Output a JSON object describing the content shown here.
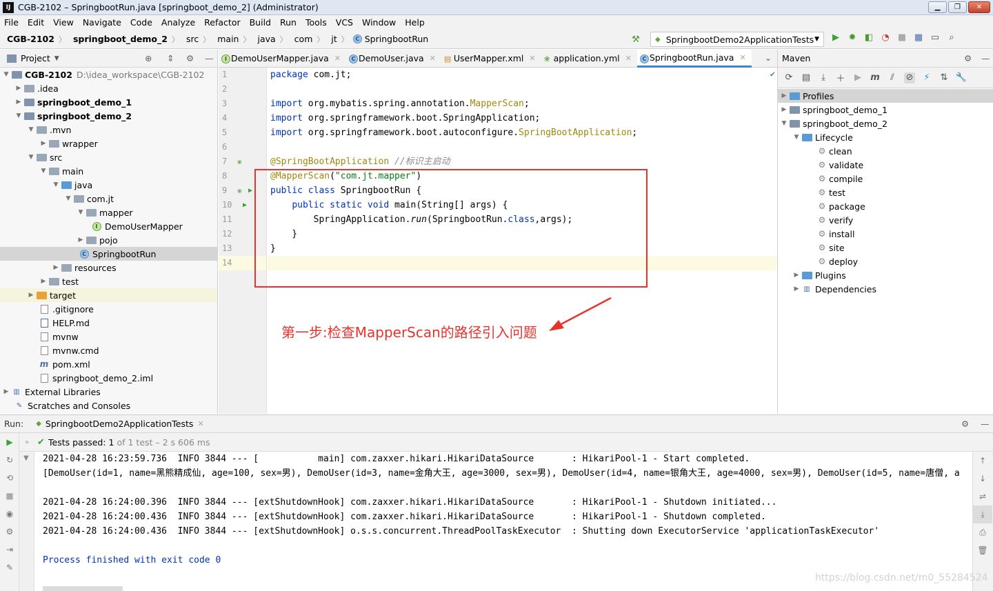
{
  "window": {
    "title": "CGB-2102 – SpringbootRun.java [springboot_demo_2] (Administrator)"
  },
  "menu": [
    "File",
    "Edit",
    "View",
    "Navigate",
    "Code",
    "Analyze",
    "Refactor",
    "Build",
    "Run",
    "Tools",
    "VCS",
    "Window",
    "Help"
  ],
  "breadcrumbs": [
    "CGB-2102",
    "springboot_demo_2",
    "src",
    "main",
    "java",
    "com",
    "jt",
    "SpringbootRun"
  ],
  "run_config": "SpringbootDemo2ApplicationTests",
  "project_panel": {
    "title": "Project",
    "tree": [
      {
        "label": "CGB-2102",
        "hint": "D:\\idea_workspace\\CGB-2102"
      },
      {
        "label": ".idea"
      },
      {
        "label": "springboot_demo_1"
      },
      {
        "label": "springboot_demo_2"
      },
      {
        "label": ".mvn"
      },
      {
        "label": "wrapper"
      },
      {
        "label": "src"
      },
      {
        "label": "main"
      },
      {
        "label": "java"
      },
      {
        "label": "com.jt"
      },
      {
        "label": "mapper"
      },
      {
        "label": "DemoUserMapper"
      },
      {
        "label": "pojo"
      },
      {
        "label": "SpringbootRun"
      },
      {
        "label": "resources"
      },
      {
        "label": "test"
      },
      {
        "label": "target"
      },
      {
        "label": ".gitignore"
      },
      {
        "label": "HELP.md"
      },
      {
        "label": "mvnw"
      },
      {
        "label": "mvnw.cmd"
      },
      {
        "label": "pom.xml"
      },
      {
        "label": "springboot_demo_2.iml"
      },
      {
        "label": "External Libraries"
      },
      {
        "label": "Scratches and Consoles"
      }
    ]
  },
  "editor_tabs": [
    "DemoUserMapper.java",
    "DemoUser.java",
    "UserMapper.xml",
    "application.yml",
    "SpringbootRun.java"
  ],
  "line_numbers": [
    "1",
    "2",
    "3",
    "4",
    "5",
    "6",
    "7",
    "8",
    "9",
    "10",
    "11",
    "12",
    "13",
    "14"
  ],
  "code": {
    "l1_kw": "package",
    "l1_rest": " com.jt;",
    "l3_kw": "import",
    "l3_rest": " org.mybatis.spring.annotation.",
    "l3_cls": "MapperScan",
    "l3_end": ";",
    "l4_kw": "import",
    "l4_rest": " org.springframework.boot.SpringApplication;",
    "l5_kw": "import",
    "l5_rest": " org.springframework.boot.autoconfigure.",
    "l5_cls": "SpringBootApplication",
    "l5_end": ";",
    "l7_an": "@SpringBootApplication",
    "l7_cm": " //标识主启动",
    "l8_an": "@MapperScan",
    "l8_p1": "(",
    "l8_str": "\"com.jt.mapper\"",
    "l8_p2": ")",
    "l9_kw": "public class",
    "l9_rest": " SpringbootRun {",
    "l10_indent": "    ",
    "l10_kw": "public static void",
    "l10_rest": " main(String[] args) {",
    "l11_indent": "        ",
    "l11_a": "SpringApplication.",
    "l11_it": "run",
    "l11_b": "(SpringbootRun.",
    "l11_kw": "class",
    "l11_c": ",args);",
    "l12": "    }",
    "l13": "}"
  },
  "annotation": "第一步:检查MapperScan的路径引入问题",
  "maven": {
    "title": "Maven",
    "profiles": "Profiles",
    "demo1": "springboot_demo_1",
    "demo2": "springboot_demo_2",
    "lifecycle": "Lifecycle",
    "goals": [
      "clean",
      "validate",
      "compile",
      "test",
      "package",
      "verify",
      "install",
      "site",
      "deploy"
    ],
    "plugins": "Plugins",
    "dependencies": "Dependencies"
  },
  "run_panel": {
    "label": "Run:",
    "tab": "SpringbootDemo2ApplicationTests",
    "tests_passed": "Tests passed:",
    "passed_count": "1",
    "passed_detail": "of 1 test – 2 s 606 ms",
    "console": [
      "2021-04-28 16:23:59.736  INFO 3844 --- [           main] com.zaxxer.hikari.HikariDataSource       : HikariPool-1 - Start completed.",
      "[DemoUser(id=1, name=黑熊精成仙, age=100, sex=男), DemoUser(id=3, name=金角大王, age=3000, sex=男), DemoUser(id=4, name=银角大王, age=4000, sex=男), DemoUser(id=5, name=唐僧, a",
      "",
      "2021-04-28 16:24:00.396  INFO 3844 --- [extShutdownHook] com.zaxxer.hikari.HikariDataSource       : HikariPool-1 - Shutdown initiated...",
      "2021-04-28 16:24:00.436  INFO 3844 --- [extShutdownHook] com.zaxxer.hikari.HikariDataSource       : HikariPool-1 - Shutdown completed.",
      "2021-04-28 16:24:00.436  INFO 3844 --- [extShutdownHook] o.s.s.concurrent.ThreadPoolTaskExecutor  : Shutting down ExecutorService 'applicationTaskExecutor'",
      "",
      "Process finished with exit code 0"
    ]
  },
  "watermark": "https://blog.csdn.net/m0_55284524",
  "colors": {
    "keyword": "#0033b3",
    "annotation": "#9e880d",
    "string": "#067d17",
    "comment": "#8c8c8c",
    "highlight_box": "#e8322c",
    "tab_underline": "#4083c9"
  }
}
